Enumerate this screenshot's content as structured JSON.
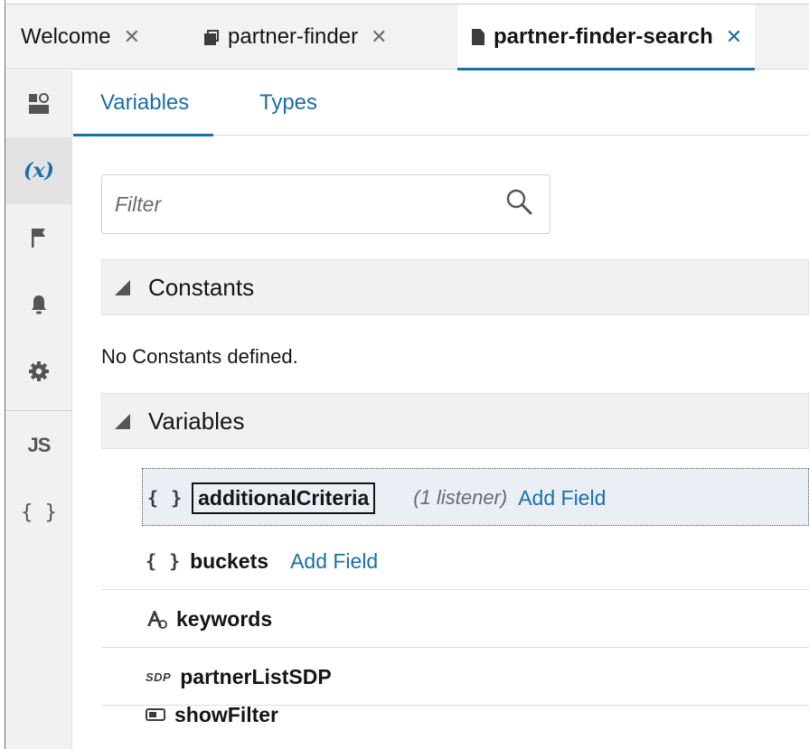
{
  "tabs": [
    {
      "label": "Welcome",
      "icon": "none",
      "active": false
    },
    {
      "label": "partner-finder",
      "icon": "stack-icon",
      "active": false
    },
    {
      "label": "partner-finder-search",
      "icon": "document-icon",
      "active": true
    }
  ],
  "tab_close_glyph": "✕",
  "rail": {
    "items": [
      {
        "name": "overview-icon",
        "active": false
      },
      {
        "name": "variables-icon",
        "label": "(x)",
        "active": true
      },
      {
        "name": "flag-icon",
        "active": false
      },
      {
        "name": "bell-icon",
        "active": false
      },
      {
        "name": "gear-icon",
        "active": false
      },
      {
        "name": "javascript-icon",
        "label": "JS",
        "active": false
      },
      {
        "name": "json-icon",
        "label": "{ }",
        "active": false
      }
    ]
  },
  "subtabs": {
    "variables": "Variables",
    "types": "Types"
  },
  "filter": {
    "placeholder": "Filter"
  },
  "sections": {
    "constants": {
      "title": "Constants",
      "empty_message": "No Constants defined."
    },
    "variables": {
      "title": "Variables",
      "items": [
        {
          "name": "additionalCriteria",
          "icon": "object-icon",
          "icon_text": "{ }",
          "listener": "(1 listener)",
          "action": "Add Field",
          "selected": true
        },
        {
          "name": "buckets",
          "icon": "object-icon",
          "icon_text": "{ }",
          "action": "Add Field",
          "selected": false
        },
        {
          "name": "keywords",
          "icon": "string-type-icon",
          "selected": false
        },
        {
          "name": "partnerListSDP",
          "icon": "sdp-icon",
          "icon_text": "SDP",
          "selected": false
        },
        {
          "name": "showFilter",
          "icon": "boolean-toggle-icon",
          "selected": false
        }
      ]
    }
  },
  "colors": {
    "accent": "#1a6fa8",
    "text": "#161513",
    "muted": "#6b6b6b",
    "selected_row_bg": "#e9eff5",
    "panel_bg": "#f1f1f1"
  }
}
